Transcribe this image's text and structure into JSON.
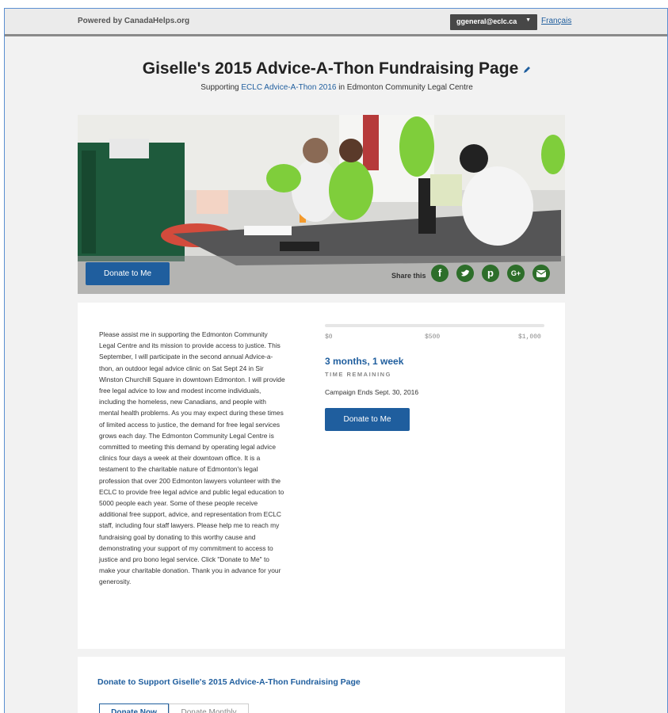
{
  "header": {
    "powered_by": "Powered by CanadaHelps.org",
    "account_label": "ggeneral@eclc.ca",
    "language_link": "Français"
  },
  "page": {
    "title": "Giselle's 2015 Advice-A-Thon Fundraising Page",
    "subtitle_prefix": "Supporting",
    "campaign_link": "ECLC Advice-A-Thon 2016",
    "subtitle_suffix": "in Edmonton Community Legal Centre"
  },
  "hero": {
    "donate_label": "Donate to Me",
    "share_label": "Share this",
    "social_icons": [
      "facebook-icon",
      "twitter-icon",
      "pinterest-icon",
      "google-plus-icon",
      "email-icon"
    ]
  },
  "description": "Please assist me in supporting the Edmonton Community Legal Centre and its mission to provide access to justice. This September, I will participate in the second annual Advice-a-thon, an outdoor legal advice clinic on Sat Sept 24 in Sir Winston Churchill Square in downtown Edmonton.  I will provide free legal advice to low and modest income individuals, including the homeless, new Canadians, and people with mental health problems.  As you may expect during these times of limited access to justice, the demand for free legal services grows each day. The Edmonton Community Legal Centre is committed to meeting this demand by operating legal advice clinics four days a week at their downtown office.  It is a testament to the charitable nature of Edmonton's legal profession that over 200 Edmonton lawyers volunteer with the ECLC to provide free legal advice and public legal education to 5000 people each year.  Some of these people receive additional free support, advice, and representation from ECLC staff, including four staff lawyers.  Please help me to reach my fundraising goal by donating to this worthy cause and demonstrating your support of my commitment to access to justice and pro bono legal service.  Click \"Donate to Me\" to make your charitable donation.  Thank you in advance for your generosity.",
  "campaign": {
    "goal_ticks": [
      "$0",
      "$500",
      "$1,000"
    ],
    "raised_fraction": 0,
    "time_remaining": "3 months, 1 week",
    "time_remaining_label": "TIME REMAINING",
    "ends_text": "Campaign Ends Sept. 30, 2016",
    "donate_label": "Donate to Me"
  },
  "support": {
    "title": "Donate to Support Giselle's 2015 Advice-A-Thon Fundraising Page",
    "tabs": [
      "Donate Now",
      "Donate Monthly"
    ],
    "selected_tab": "Donate Now"
  },
  "colors": {
    "accent_blue": "#1f5e9e",
    "social_green": "#2d6e2a",
    "account_bg": "#474747"
  }
}
